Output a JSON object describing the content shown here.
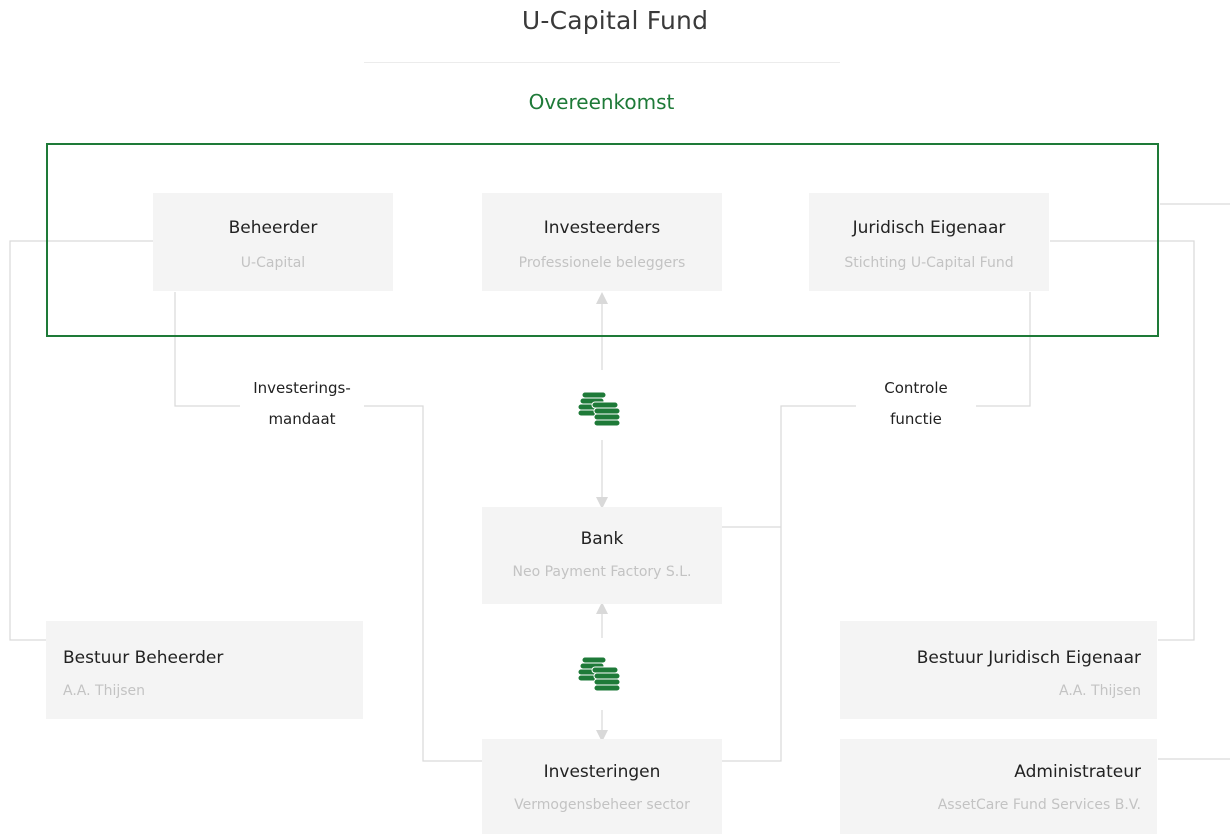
{
  "header": {
    "title": "U-Capital Fund",
    "subtitle": "Overeenkomst"
  },
  "nodes": {
    "beheerder": {
      "name": "Beheerder",
      "sub": "U-Capital"
    },
    "investeerders": {
      "name": "Investeerders",
      "sub": "Professionele beleggers"
    },
    "juridisch": {
      "name": "Juridisch Eigenaar",
      "sub": "Stichting U-Capital Fund"
    },
    "bank": {
      "name": "Bank",
      "sub": "Neo Payment Factory S.L."
    },
    "bestuur_beheerder": {
      "name": "Bestuur Beheerder",
      "sub": "A.A. Thijsen"
    },
    "bestuur_juridisch": {
      "name": "Bestuur Juridisch Eigenaar",
      "sub": "A.A. Thijsen"
    },
    "investeringen": {
      "name": "Investeringen",
      "sub": "Vermogensbeheer sector"
    },
    "administrateur": {
      "name": "Administrateur",
      "sub": "AssetCare Fund Services B.V."
    }
  },
  "labels": {
    "mandaat_1": "Investerings-",
    "mandaat_2": "mandaat",
    "controle_1": "Controle",
    "controle_2": "functie"
  },
  "icons": {
    "coins_top": "coins-icon",
    "coins_bottom": "coins-icon"
  },
  "colors": {
    "accent": "#1e7a38",
    "box": "#f4f4f4",
    "line": "#d9d9d9",
    "muted": "#c3c3c3"
  }
}
